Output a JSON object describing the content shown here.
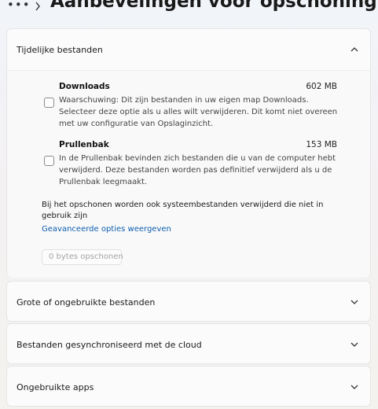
{
  "header": {
    "ellipsis": "•••",
    "title": "Aanbevelingen voor opschoning"
  },
  "temp_files": {
    "title": "Tijdelijke bestanden",
    "expanded": true,
    "items": [
      {
        "name": "Downloads",
        "size": "602 MB",
        "description": "Waarschuwing: Dit zijn bestanden in uw eigen map Downloads. Selecteer deze optie als u alles wilt verwijderen. Dit komt niet overeen met uw configuratie van Opslaginzicht.",
        "checked": false
      },
      {
        "name": "Prullenbak",
        "size": "153 MB",
        "description": "In de Prullenbak bevinden zich bestanden die u van de computer hebt verwijderd. Deze bestanden worden pas definitief verwijderd als u de Prullenbak leegmaakt.",
        "checked": false
      }
    ],
    "note": "Bij het opschonen worden ook systeembestanden verwijderd die niet in gebruik zijn",
    "advanced_link": "Geavanceerde opties weergeven",
    "clean_button": "0 bytes opschonen"
  },
  "sections": [
    {
      "title": "Grote of ongebruikte bestanden",
      "expanded": false
    },
    {
      "title": "Bestanden gesynchroniseerd met de cloud",
      "expanded": false
    },
    {
      "title": "Ongebruikte apps",
      "expanded": false
    }
  ],
  "colors": {
    "link": "#0b5cad",
    "card_bg": "#fbfbfb",
    "disabled_text": "#a3a3a3"
  }
}
